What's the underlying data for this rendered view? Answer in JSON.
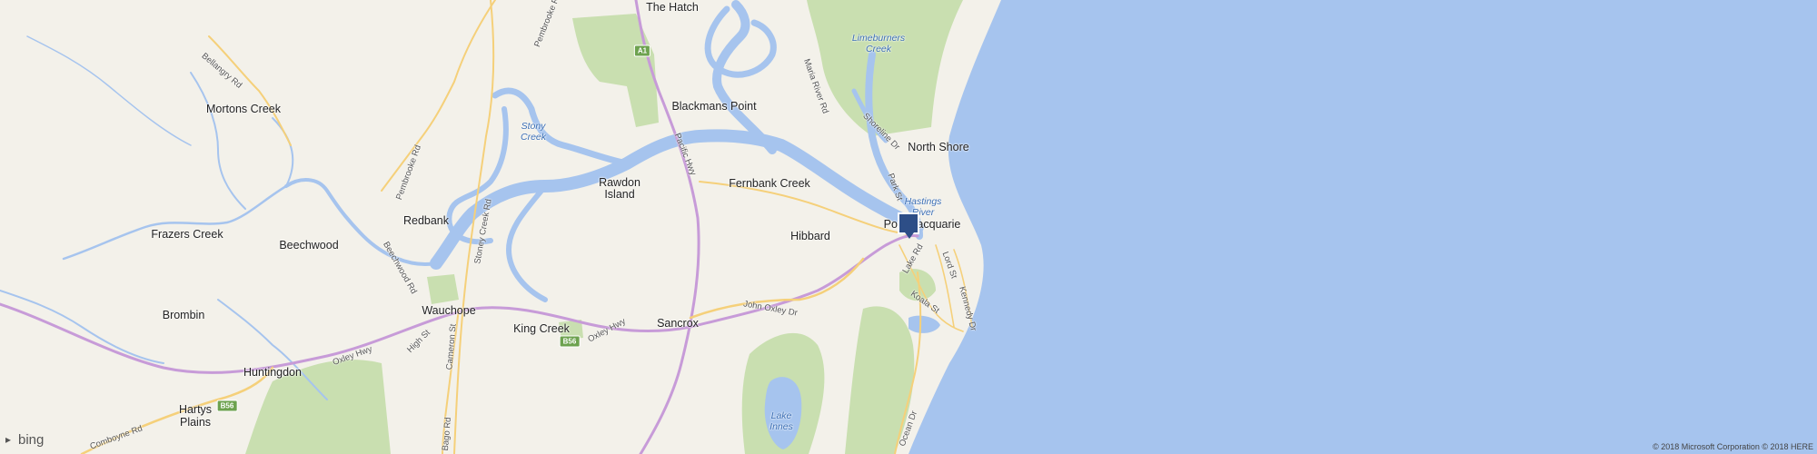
{
  "colors": {
    "land": "#f3f1ea",
    "water": "#a6c4ee",
    "park": "#c9dfb0",
    "highway": "#c79bd8",
    "road": "#f5d07a"
  },
  "places": [
    {
      "id": "the-hatch",
      "label": "The Hatch"
    },
    {
      "id": "mortons-creek",
      "label": "Mortons Creek"
    },
    {
      "id": "blackmans-point",
      "label": "Blackmans Point"
    },
    {
      "id": "north-shore",
      "label": "North Shore"
    },
    {
      "id": "rawdon-island-1",
      "label": "Rawdon"
    },
    {
      "id": "rawdon-island-2",
      "label": "Island"
    },
    {
      "id": "fernbank-creek",
      "label": "Fernbank Creek"
    },
    {
      "id": "redbank",
      "label": "Redbank"
    },
    {
      "id": "frazers-creek",
      "label": "Frazers Creek"
    },
    {
      "id": "beechwood",
      "label": "Beechwood"
    },
    {
      "id": "hibbard",
      "label": "Hibbard"
    },
    {
      "id": "port-macquarie",
      "label": "Port Macquarie"
    },
    {
      "id": "brombin",
      "label": "Brombin"
    },
    {
      "id": "wauchope",
      "label": "Wauchope"
    },
    {
      "id": "king-creek",
      "label": "King Creek"
    },
    {
      "id": "sancrox",
      "label": "Sancrox"
    },
    {
      "id": "huntingdon",
      "label": "Huntingdon"
    },
    {
      "id": "hartys-plains-1",
      "label": "Hartys"
    },
    {
      "id": "hartys-plains-2",
      "label": "Plains"
    }
  ],
  "water_labels": [
    {
      "id": "limeburners-creek",
      "label": "Limeburners Creek"
    },
    {
      "id": "stony-creek",
      "label": "Stony Creek"
    },
    {
      "id": "hastings-river",
      "label": "Hastings River"
    },
    {
      "id": "lake-innes",
      "label": "Lake Innes"
    }
  ],
  "road_labels": [
    {
      "id": "pembrooke-rd-top",
      "label": "Pembrooke Rd"
    },
    {
      "id": "bellangry-rd",
      "label": "Bellangry Rd"
    },
    {
      "id": "maria-river-rd",
      "label": "Maria River Rd"
    },
    {
      "id": "shoreline-dr",
      "label": "Shoreline Dr"
    },
    {
      "id": "pacific-hwy",
      "label": "Pacific Hwy"
    },
    {
      "id": "pembrooke-rd-mid",
      "label": "Pembrooke Rd"
    },
    {
      "id": "park-st",
      "label": "Park St"
    },
    {
      "id": "stoney-creek-rd",
      "label": "Stoney Creek Rd"
    },
    {
      "id": "beechwood-rd",
      "label": "Beechwood Rd"
    },
    {
      "id": "lake-rd",
      "label": "Lake Rd"
    },
    {
      "id": "lord-st",
      "label": "Lord St"
    },
    {
      "id": "john-oxley-dr",
      "label": "John Oxley Dr"
    },
    {
      "id": "koala-st",
      "label": "Koala St"
    },
    {
      "id": "kennedy-dr",
      "label": "Kennedy Dr"
    },
    {
      "id": "oxley-hwy-east",
      "label": "Oxley Hwy"
    },
    {
      "id": "high-st",
      "label": "High St"
    },
    {
      "id": "oxley-hwy-west",
      "label": "Oxley Hwy"
    },
    {
      "id": "cameron-st",
      "label": "Cameron St"
    },
    {
      "id": "bago-rd",
      "label": "Bago Rd"
    },
    {
      "id": "ocean-dr",
      "label": "Ocean Dr"
    },
    {
      "id": "comboyne-rd",
      "label": "Comboyne Rd"
    }
  ],
  "shields": [
    {
      "id": "a1",
      "label": "A1"
    },
    {
      "id": "b56-east",
      "label": "B56"
    },
    {
      "id": "b56-west",
      "label": "B56"
    }
  ],
  "brand": {
    "name": "bing",
    "icon": "bing-logo-icon"
  },
  "copyright": "© 2018 Microsoft Corporation © 2018 HERE"
}
